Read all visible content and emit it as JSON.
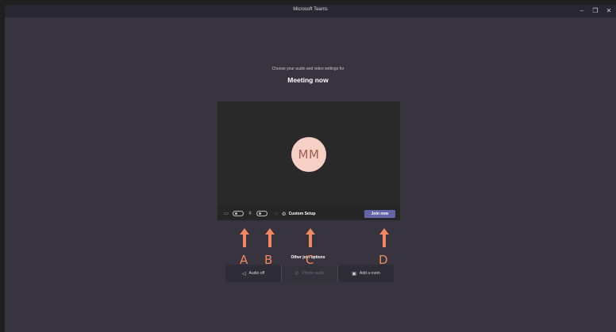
{
  "window": {
    "title": "Microsoft Teams",
    "controls": {
      "minimize": "–",
      "restore": "❐",
      "close": "✕"
    }
  },
  "prejoin": {
    "subtitle": "Choose your audio and video settings for",
    "meeting_title": "Meeting now",
    "avatar_initials": "MM"
  },
  "controls": {
    "camera_icon": "camera-icon",
    "mic_icon": "mic-off-icon",
    "blur_icon": "background-effects-icon",
    "custom_setup_label": "Custom Setup",
    "join_label": "Join now"
  },
  "annotations": {
    "labels": [
      "A",
      "B",
      "C",
      "D"
    ],
    "color": "#f08860"
  },
  "other_join": {
    "heading": "Other join options",
    "options": [
      {
        "label": "Audio off",
        "icon": "speaker-off-icon",
        "enabled": true
      },
      {
        "label": "Phone audio",
        "icon": "phone-icon",
        "enabled": false
      },
      {
        "label": "Add a room",
        "icon": "cast-icon",
        "enabled": true
      }
    ]
  },
  "colors": {
    "background": "#37343f",
    "titlebar": "#282631",
    "accent": "#6264a7",
    "avatar_bg": "#f6d0c5",
    "avatar_text": "#a25b4f"
  }
}
